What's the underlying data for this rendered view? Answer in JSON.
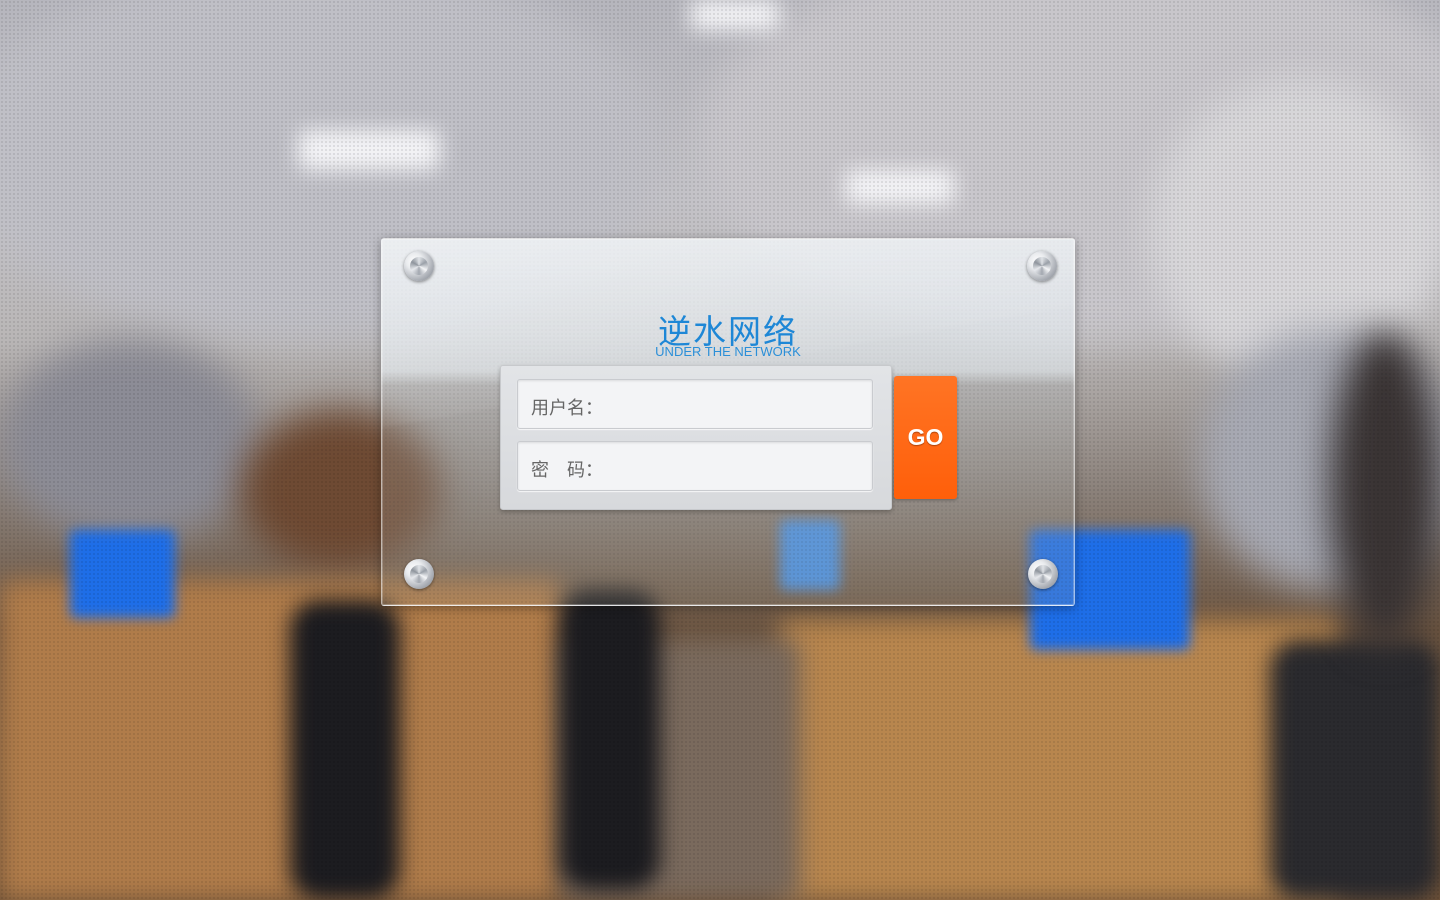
{
  "brand": {
    "title": "逆水网络",
    "subtitle": "UNDER THE NETWORK",
    "color": "#1e87d6"
  },
  "login": {
    "username_label": "用户名：",
    "password_label": "密　码：",
    "go_label": "GO",
    "go_color": "#ff6510"
  },
  "icons": {
    "screw": "screw-icon"
  }
}
